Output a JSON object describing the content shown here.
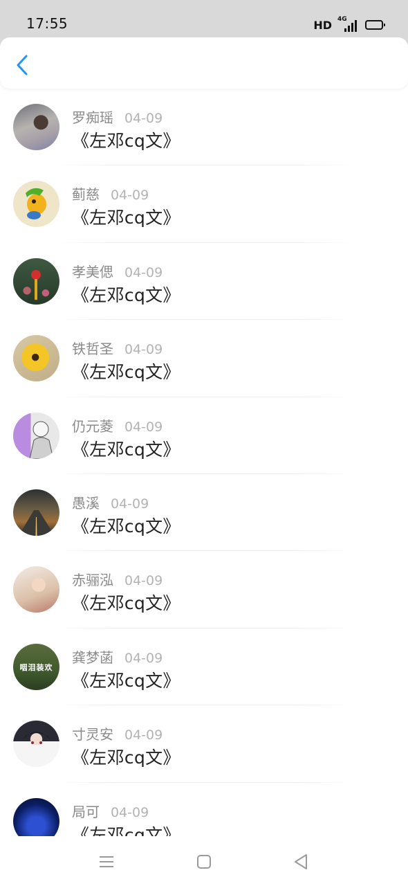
{
  "status_bar": {
    "time": "17:55",
    "hd_label": "HD",
    "network_label": "4G",
    "battery_color": "#f5c518"
  },
  "header": {
    "back_icon": "chevron-left-icon",
    "accent_color": "#2196f3"
  },
  "list": {
    "items": [
      {
        "name": "罗痴瑶",
        "date": "04-09",
        "title": "《左邓cq文》"
      },
      {
        "name": "蓟慈",
        "date": "04-09",
        "title": "《左邓cq文》"
      },
      {
        "name": "孝美偲",
        "date": "04-09",
        "title": "《左邓cq文》"
      },
      {
        "name": "铁哲圣",
        "date": "04-09",
        "title": "《左邓cq文》"
      },
      {
        "name": "仍元菱",
        "date": "04-09",
        "title": "《左邓cq文》"
      },
      {
        "name": "愚溪",
        "date": "04-09",
        "title": "《左邓cq文》"
      },
      {
        "name": "赤骊泓",
        "date": "04-09",
        "title": "《左邓cq文》"
      },
      {
        "name": "龚梦菡",
        "date": "04-09",
        "title": "《左邓cq文》",
        "avatar_text": "咽泪装欢"
      },
      {
        "name": "寸灵安",
        "date": "04-09",
        "title": "《左邓cq文》"
      },
      {
        "name": "局可",
        "date": "04-09",
        "title": "《左邓cq文》"
      }
    ]
  },
  "nav_bar": {
    "menu_icon": "menu-icon",
    "home_icon": "home-square-icon",
    "back_icon": "back-triangle-icon"
  }
}
